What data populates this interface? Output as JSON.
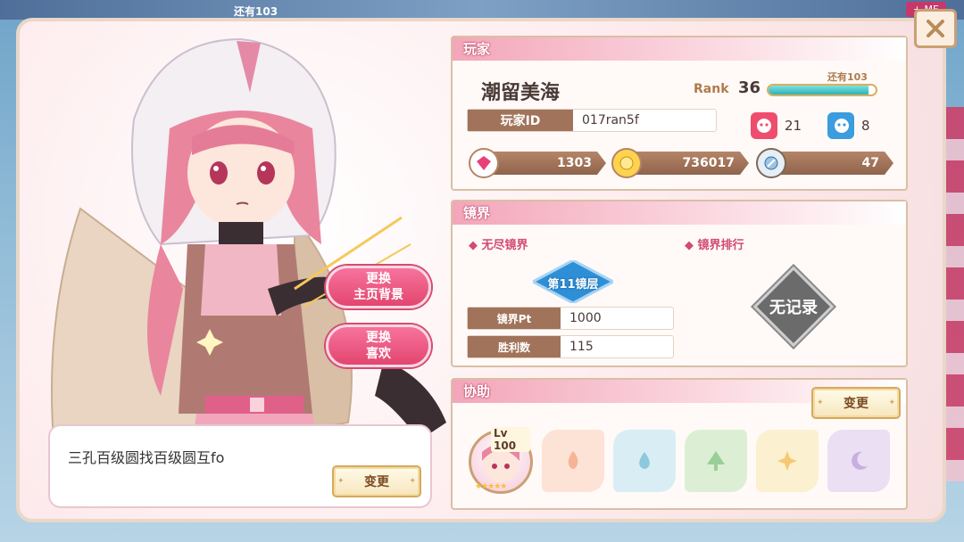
{
  "backdrop": {
    "top_text": "还有103",
    "top_badge": "+ ME"
  },
  "character": {
    "change_background_line1": "更换",
    "change_background_line2": "主页背景",
    "change_favorite_line1": "更换",
    "change_favorite_line2": "喜欢"
  },
  "comment": {
    "text": "三孔百级圆找百级圆互fo",
    "change_label": "变更"
  },
  "player": {
    "section_title": "玩家",
    "name": "潮留美海",
    "rank_label": "Rank",
    "rank_value": "36",
    "rank_remaining": "还有103",
    "rank_progress": 0.93,
    "id_label": "玩家ID",
    "id_value": "017ran5f",
    "stat_red": "21",
    "stat_blue": "8",
    "gems": "1303",
    "coins": "736017",
    "tickets": "47"
  },
  "mirror": {
    "section_title": "镜界",
    "endless_title": "无尽镜界",
    "ranking_title": "镜界排行",
    "floor": "第11镜层",
    "pt_label": "镜界Pt",
    "pt_value": "1000",
    "wins_label": "胜利数",
    "wins_value": "115",
    "no_record": "无记录"
  },
  "support": {
    "section_title": "协助",
    "change_label": "变更",
    "level_tag": "Lv 100",
    "stars": "★★★★★",
    "slots": [
      "fire",
      "water",
      "forest",
      "light",
      "dark"
    ]
  },
  "colors": {
    "accent_pink": "#e2466f",
    "brown": "#a0735a",
    "gold": "#d6a95e",
    "rank_bar": "#2ab3b7"
  }
}
